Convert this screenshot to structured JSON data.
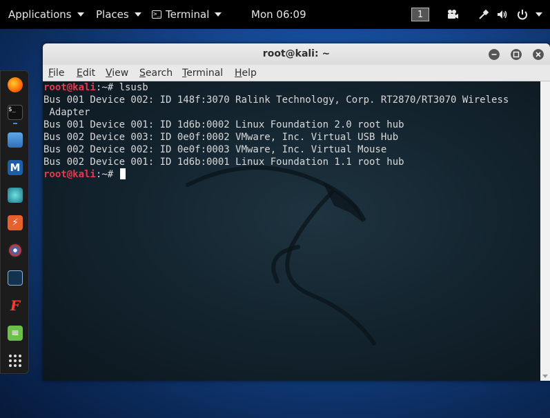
{
  "topbar": {
    "applications": "Applications",
    "places": "Places",
    "app_name": "Terminal",
    "clock": "Mon 06:09",
    "workspace": "1"
  },
  "dock": {
    "items": [
      "firefox-icon",
      "terminal-icon",
      "files-icon",
      "metasploit-icon",
      "armitage-icon",
      "burpsuite-icon",
      "maltego-icon",
      "beef-icon",
      "faraday-icon",
      "leafpad-icon",
      "show-apps-icon"
    ]
  },
  "window": {
    "title": "root@kali: ~",
    "menu": [
      {
        "mnemonic": "F",
        "rest": "ile"
      },
      {
        "mnemonic": "E",
        "rest": "dit"
      },
      {
        "mnemonic": "V",
        "rest": "iew"
      },
      {
        "mnemonic": "S",
        "rest": "earch"
      },
      {
        "mnemonic": "T",
        "rest": "erminal"
      },
      {
        "mnemonic": "H",
        "rest": "elp"
      }
    ]
  },
  "terminal": {
    "prompt_user": "root@kali",
    "prompt_path": ":~# ",
    "command": "lsusb",
    "output": [
      "Bus 001 Device 002: ID 148f:3070 Ralink Technology, Corp. RT2870/RT3070 Wireless",
      " Adapter",
      "Bus 001 Device 001: ID 1d6b:0002 Linux Foundation 2.0 root hub",
      "Bus 002 Device 003: ID 0e0f:0002 VMware, Inc. Virtual USB Hub",
      "Bus 002 Device 002: ID 0e0f:0003 VMware, Inc. Virtual Mouse",
      "Bus 002 Device 001: ID 1d6b:0001 Linux Foundation 1.1 root hub"
    ]
  },
  "colors": {
    "prompt": "#e8384f",
    "topbar_bg": "#000000",
    "terminal_text": "#d9d9d9"
  }
}
